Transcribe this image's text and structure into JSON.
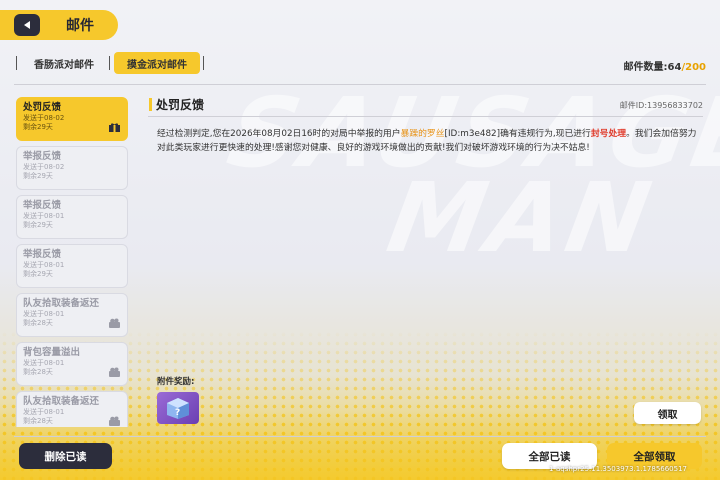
{
  "header": {
    "title": "邮件"
  },
  "tabs": [
    {
      "label": "香肠派对邮件"
    },
    {
      "label": "摸金派对邮件"
    }
  ],
  "mail_count": {
    "label": "邮件数量:",
    "current": "64",
    "separator": "/",
    "max": "200"
  },
  "mails": [
    {
      "title": "处罚反馈",
      "sent": "发送于08-02",
      "remain": "剩余29天",
      "selected": true,
      "has_gift": true
    },
    {
      "title": "举报反馈",
      "sent": "发送于08-02",
      "remain": "剩余29天",
      "selected": false,
      "has_gift": false
    },
    {
      "title": "举报反馈",
      "sent": "发送于08-01",
      "remain": "剩余29天",
      "selected": false,
      "has_gift": false
    },
    {
      "title": "举报反馈",
      "sent": "发送于08-01",
      "remain": "剩余29天",
      "selected": false,
      "has_gift": false
    },
    {
      "title": "队友拾取装备返还",
      "sent": "发送于08-01",
      "remain": "剩余28天",
      "selected": false,
      "has_gift": true
    },
    {
      "title": "背包容量溢出",
      "sent": "发送于08-01",
      "remain": "剩余28天",
      "selected": false,
      "has_gift": true
    },
    {
      "title": "队友拾取装备返还",
      "sent": "发送于08-01",
      "remain": "剩余28天",
      "selected": false,
      "has_gift": true
    }
  ],
  "detail": {
    "title": "处罚反馈",
    "mail_id": "邮件ID:13956833702",
    "body_part1": "经过检测判定,您在2026年08月02日16时的对局中举报的用户",
    "body_user": "暴躁的罗丝",
    "body_part2": "[ID:m3e482]确有违规行为,现已进行",
    "body_ban": "封号处理",
    "body_part3": "。我们会加倍努力对此类玩家进行更快速的处理!感谢您对健康、良好的游戏环境做出的贡献!我们对破坏游戏环境的行为决不姑息!",
    "attachment_label": "附件奖励:",
    "claim_label": "领取"
  },
  "bottom": {
    "delete_read": "删除已读",
    "read_all": "全部已读",
    "claim_all": "全部领取"
  },
  "uid_text": "1-aqshpr25.11.3503973.1.1785660517",
  "watermark_text_1": "SAUSAGE",
  "watermark_text_2": "MAN",
  "colors": {
    "accent": "#f6c82c",
    "dark": "#2c2d3c",
    "user_highlight": "#e8941a",
    "ban_highlight": "#e03a2a"
  }
}
